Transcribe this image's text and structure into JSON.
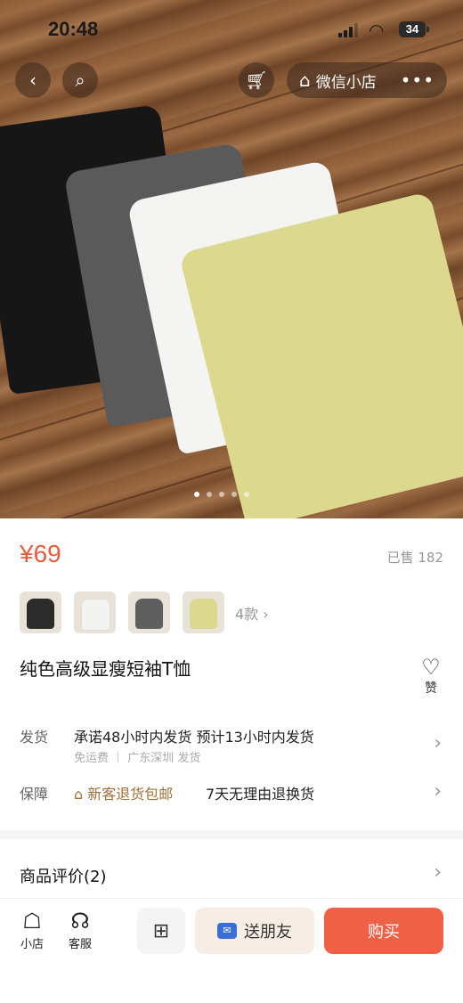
{
  "status_bar": {
    "time": "20:48",
    "battery": "34"
  },
  "top_nav": {
    "shop_label": "微信小店",
    "more_label": "•••"
  },
  "gallery": {
    "slides": 5,
    "active": 0
  },
  "product": {
    "price": "¥69",
    "sold": "已售 182",
    "variant_count": "4款",
    "title": "纯色高级显瘦短袖T恤",
    "like_label": "赞",
    "variants": [
      {
        "color": "#2b2b2b"
      },
      {
        "color": "#f3f3f1"
      },
      {
        "color": "#5f5f5f"
      },
      {
        "color": "#dcd98f"
      }
    ]
  },
  "shipping": {
    "label": "发货",
    "main": "承诺48小时内发货  预计13小时内发货",
    "sub": "免运费  ｜ 广东深圳 发货"
  },
  "guarantee": {
    "label": "保障",
    "item1": "新客退货包邮",
    "item2": "7天无理由退换货"
  },
  "reviews": {
    "label": "商品评价(2)"
  },
  "bottom_bar": {
    "shop_label": "小店",
    "service_label": "客服",
    "share_label": "送朋友",
    "buy_label": "购买"
  },
  "colors": {
    "accent": "#ec5a3c",
    "buy_button": "#ef6047",
    "share_bg": "#f6eee4"
  }
}
